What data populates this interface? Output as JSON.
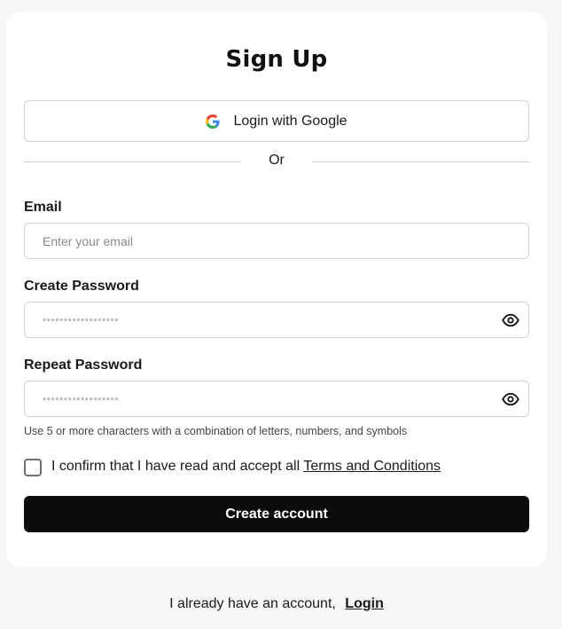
{
  "title": "Sign Up",
  "google_button": {
    "label": "Login with Google",
    "icon": "google-icon"
  },
  "divider_text": "Or",
  "email": {
    "label": "Email",
    "placeholder": "Enter your email"
  },
  "create_password": {
    "label": "Create Password",
    "placeholder": "******************",
    "icon": "eye-icon"
  },
  "repeat_password": {
    "label": "Repeat Password",
    "placeholder": "******************",
    "icon": "eye-icon"
  },
  "password_hint": "Use 5 or more characters with a combination of letters, numbers, and symbols",
  "confirm": {
    "text": "I confirm that I have read and accept all",
    "link": "Terms and Conditions",
    "checked": false
  },
  "create_button": "Create account",
  "footer": {
    "text": "I already have an account,",
    "link": "Login"
  },
  "colors": {
    "page_background": "#f6f7f9",
    "card_background": "#ffffff",
    "primary_button": "#0c0c0c",
    "border": "#cfcfcf"
  }
}
